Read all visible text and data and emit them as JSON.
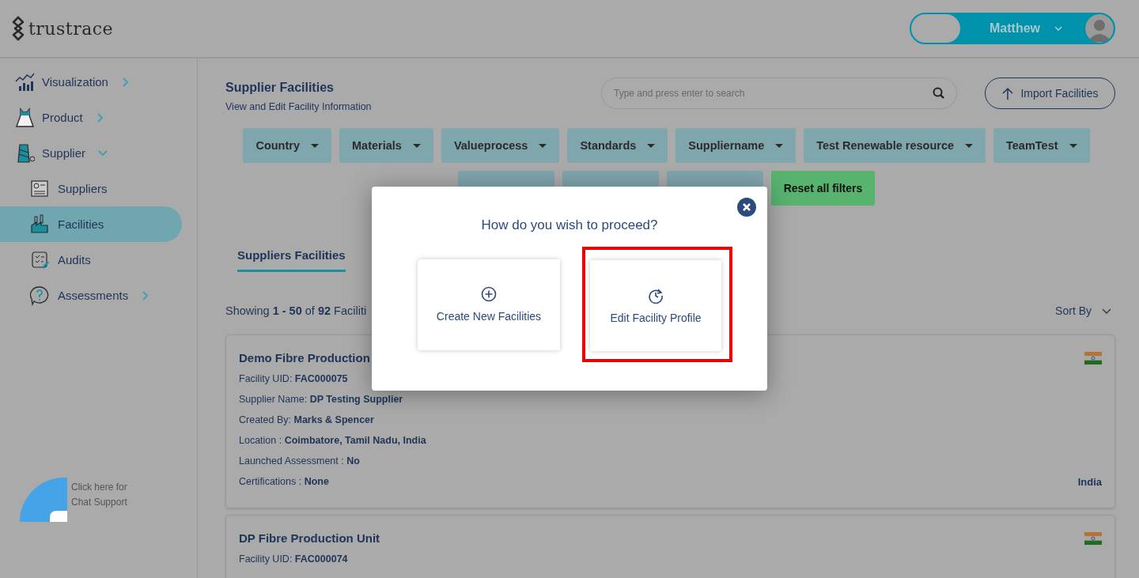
{
  "header": {
    "logo": "trustrace",
    "user": {
      "name": "Matthew"
    }
  },
  "sidebar": {
    "items": [
      {
        "label": "Visualization",
        "expanded": false,
        "selected": false
      },
      {
        "label": "Product",
        "expanded": false,
        "selected": false
      },
      {
        "label": "Supplier",
        "expanded": true,
        "selected": false,
        "children": [
          {
            "label": "Suppliers",
            "selected": false
          },
          {
            "label": "Facilities",
            "selected": true
          },
          {
            "label": "Audits",
            "selected": false
          },
          {
            "label": "Assessments",
            "expanded": false,
            "selected": false
          }
        ]
      }
    ]
  },
  "chat_support": {
    "label": "Click here for Chat Support"
  },
  "page": {
    "title": "Supplier Facilities",
    "subtitle": "View and Edit Facility Information",
    "search": {
      "placeholder": "Type and press enter to search"
    },
    "import_button": "Import Facilities",
    "filters": [
      {
        "label": "Country"
      },
      {
        "label": "Materials"
      },
      {
        "label": "Valueprocess"
      },
      {
        "label": "Standards"
      },
      {
        "label": "Suppliername"
      },
      {
        "label": "Test Renewable resource"
      },
      {
        "label": "TeamTest"
      },
      {
        "kind": "covered"
      },
      {
        "kind": "covered"
      },
      {
        "kind": "covered"
      }
    ],
    "reset_button": "Reset all filters",
    "tabs": [
      {
        "label": "Suppliers Facilities",
        "selected": true
      }
    ],
    "showing": "Showing **1 - 50** of **92** Faciliti",
    "sort": "Sort By",
    "facilities": [
      {
        "name": "Demo Fibre Production",
        "fields": [
          "Facility UID: **FAC000075**",
          "Supplier Name: **DP Testing Supplier**",
          "Created By: **Marks & Spencer**",
          "Location : **Coimbatore, Tamil Nadu, India**",
          "Launched Assessment : **No**",
          "Certifications : **None**"
        ],
        "country": "India"
      },
      {
        "name": "DP Fibre Production Unit",
        "fields": [
          "Facility UID: **FAC000074**"
        ]
      }
    ]
  },
  "modal": {
    "title": "How do you wish to proceed?",
    "options": [
      {
        "label": "Create New Facilities",
        "highlighted": false
      },
      {
        "label": "Edit Facility Profile",
        "highlighted": true
      }
    ]
  }
}
